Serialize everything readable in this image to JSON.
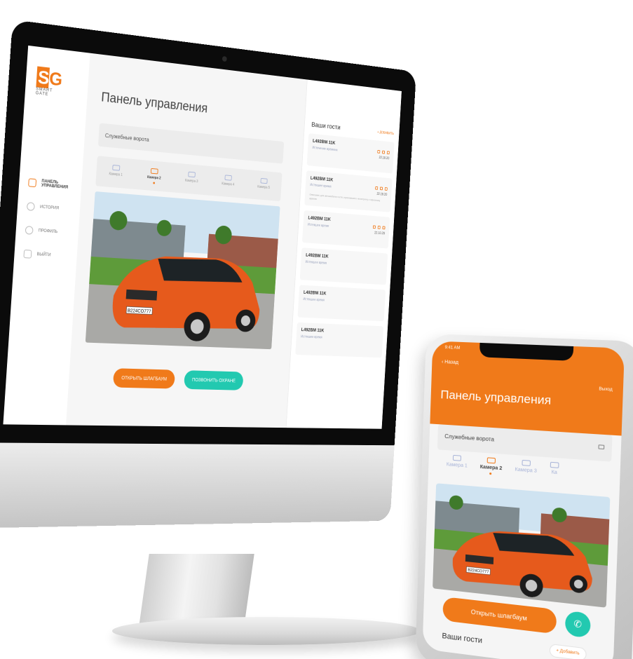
{
  "desktop": {
    "logo": {
      "mark_left": "S",
      "mark_right": "G",
      "text": "SMART GATE"
    },
    "sidebar": {
      "items": [
        {
          "label": "ПАНЕЛЬ УПРАВЛЕНИЯ",
          "icon": "dashboard-icon"
        },
        {
          "label": "ИСТОРИЯ",
          "icon": "history-icon"
        },
        {
          "label": "ПРОФИЛЬ",
          "icon": "user-icon"
        },
        {
          "label": "ВЫЙТИ",
          "icon": "logout-icon"
        }
      ]
    },
    "title": "Панель управления",
    "gate_selector": "Служебные ворота",
    "camera_tabs": [
      {
        "label": "Камера 1",
        "active": false
      },
      {
        "label": "Камера 2",
        "active": true
      },
      {
        "label": "Камера 3",
        "active": false
      },
      {
        "label": "Камера 4",
        "active": false
      },
      {
        "label": "Камера 5",
        "active": false
      }
    ],
    "plate_text": "В224СО777",
    "buttons": {
      "open_gate": "ОТКРЫТЬ ШЛАГБАУМ",
      "call_security": "ПОЗВОНИТЬ ОХРАНЕ"
    },
    "guests": {
      "title": "Ваши гости",
      "add_label": "+ ДОБАВИТЬ",
      "items": [
        {
          "plate": "L492BM 11K",
          "status": "Истечение времени",
          "desc": "",
          "date": "22.10.20"
        },
        {
          "plate": "L492BM 11K",
          "status": "Истекшее время",
          "desc": "Описание для автомобиля гостя, приехавшего на встречу к офисному зданию",
          "date": "22.10.20"
        },
        {
          "plate": "L492BM 11K",
          "status": "Истекшее время",
          "desc": "",
          "date": "22.10.20"
        },
        {
          "plate": "L492BM 11K",
          "status": "Истекшее время",
          "desc": "",
          "date": ""
        },
        {
          "plate": "L492BM 11K",
          "status": "Истекшее время",
          "desc": "",
          "date": ""
        },
        {
          "plate": "L492BM 11K",
          "status": "Истекшее время",
          "desc": "",
          "date": ""
        }
      ]
    }
  },
  "mobile": {
    "status_time": "9:41 AM",
    "back_label": "‹ Назад",
    "logout_label": "Выход",
    "title": "Панель управления",
    "gate_selector": "Служебные ворота",
    "camera_tabs": [
      {
        "label": "Камера 1",
        "active": false
      },
      {
        "label": "Камера 2",
        "active": true
      },
      {
        "label": "Камера 3",
        "active": false
      },
      {
        "label": "Ка",
        "active": false
      }
    ],
    "open_button": "Открыть шлагбаум",
    "call_icon": "phone-icon",
    "guests_title": "Ваши гости",
    "add_button": "+ Добавить"
  },
  "colors": {
    "accent": "#f07a1a",
    "teal": "#22c9b0",
    "car_body": "#e65a1c"
  }
}
